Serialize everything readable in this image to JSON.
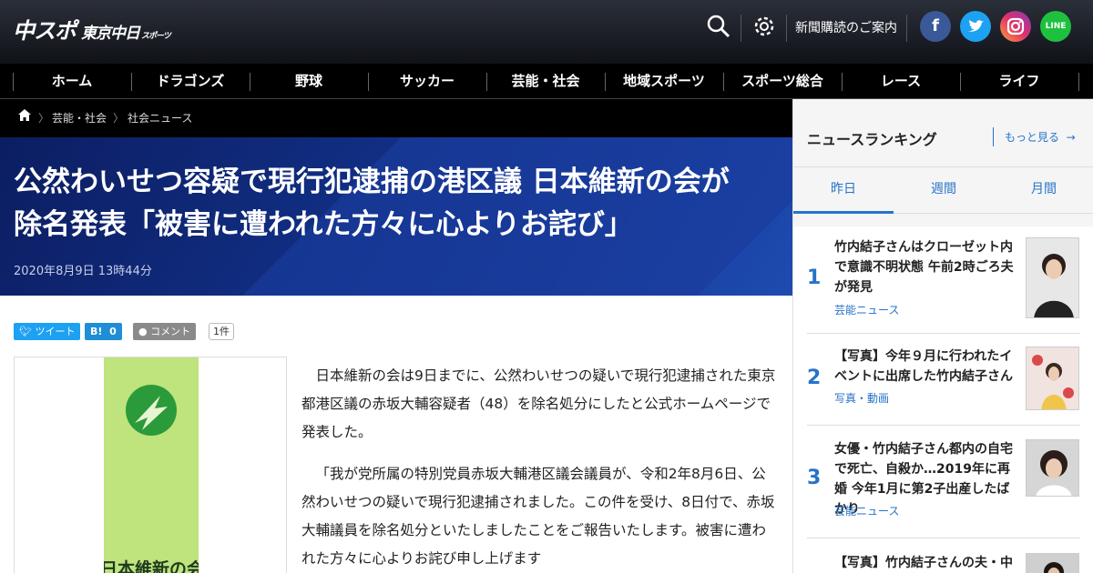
{
  "header": {
    "logo_main": "中スポ",
    "logo_sub": "東京中日",
    "logo_tiny": "スポーツ",
    "subscribe_label": "新聞購読のご案内",
    "icons": [
      "search-icon",
      "gear-icon",
      "facebook-icon",
      "twitter-icon",
      "instagram-icon",
      "line-icon"
    ],
    "social": {
      "facebook": "f",
      "line": "LINE"
    },
    "colors": {
      "facebook": "#3b5998",
      "twitter": "#1da1f2",
      "line": "#1dc13f"
    }
  },
  "nav": {
    "items": [
      "ホーム",
      "ドラゴンズ",
      "野球",
      "サッカー",
      "芸能・社会",
      "地域スポーツ",
      "スポーツ総合",
      "レース",
      "ライフ"
    ]
  },
  "breadcrumb": {
    "items": [
      "芸能・社会",
      "社会ニュース"
    ]
  },
  "article": {
    "headline_line1": "公然わいせつ容疑で現行犯逮捕の港区議 日本維新の会が",
    "headline_line2": "除名発表「被害に遭われた方々に心よりお詫び」",
    "date": "2020年8月9日 13時44分",
    "photo_caption_text": "日本維新の会",
    "paragraphs": [
      "日本維新の会は9日までに、公然わいせつの疑いで現行犯逮捕された東京都港区議の赤坂大輔容疑者（48）を除名処分にしたと公式ホームページで発表した。",
      "「我が党所属の特別党員赤坂大輔港区議会議員が、令和2年8月6日、公然わいせつの疑いで現行犯逮捕されました。この件を受け、8日付で、赤坂大輔議員を除名処分といたしましたことをご報告いたします。被害に遭われた方々に心よりお詫び申し上げます"
    ]
  },
  "share": {
    "tweet_label": "ツイート",
    "hatena_label": "B!",
    "hatena_count": "0",
    "comment_label": "コメント",
    "comment_count": "1件",
    "colors": {
      "twitter": "#1da1f2",
      "hatena": "#1f8ed6",
      "comment": "#8a8a8a"
    }
  },
  "sidebar": {
    "title": "ニュースランキング",
    "more_label": "もっと見る",
    "tabs": [
      "昨日",
      "週間",
      "月間"
    ],
    "active_tab": "昨日",
    "ranking": [
      {
        "rank": "1",
        "title": "竹内結子さんはクローゼット内で意識不明状態 午前2時ごろ夫が発見",
        "category": "芸能ニュース"
      },
      {
        "rank": "2",
        "title": "【写真】今年９月に行われたイベントに出席した竹内結子さん",
        "category": "写真・動画"
      },
      {
        "rank": "3",
        "title": "女優・竹内結子さん都内の自宅で死亡、自殺か…2019年に再婚 今年1月に第2子出産したばかり",
        "category": "芸能ニュース"
      },
      {
        "rank": "4",
        "title": "【写真】竹内結子さんの夫・中林大樹",
        "category": ""
      }
    ],
    "accent": "#2673c9"
  }
}
